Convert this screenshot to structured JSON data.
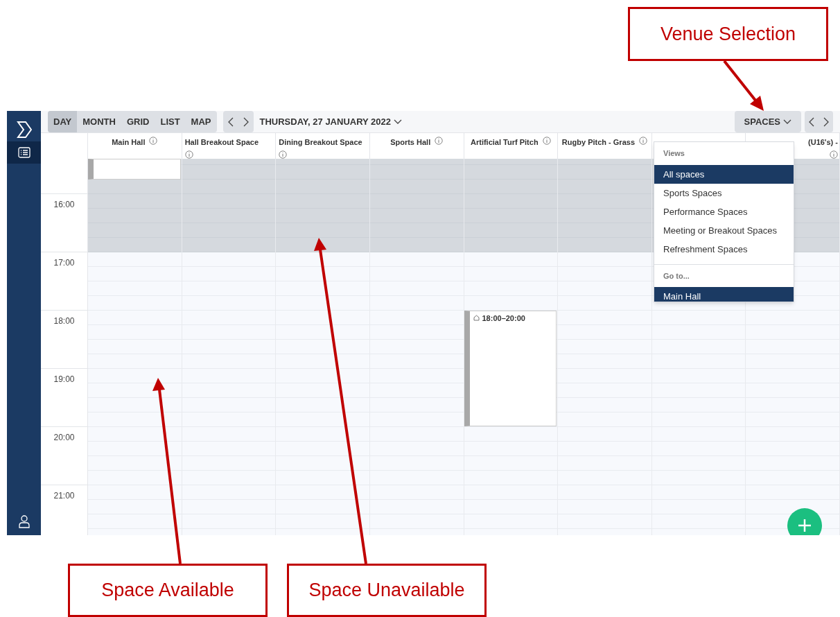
{
  "toolbar": {
    "views": [
      {
        "label": "DAY",
        "selected": true
      },
      {
        "label": "MONTH",
        "selected": false
      },
      {
        "label": "GRID",
        "selected": false
      },
      {
        "label": "LIST",
        "selected": false
      },
      {
        "label": "MAP",
        "selected": false
      }
    ],
    "date": "THURSDAY, 27 JANUARY 2022",
    "spaces_button": "SPACES"
  },
  "sidebar": {
    "items": [
      {
        "kind": "list",
        "selected": true
      },
      {
        "kind": "user",
        "selected": false
      }
    ]
  },
  "columns": [
    {
      "name": "Main Hall",
      "info_wrap": false,
      "unavailable": true,
      "events": [
        {
          "kind": "continued"
        }
      ]
    },
    {
      "name": "Hall Breakout Space",
      "info_wrap": true,
      "unavailable": true
    },
    {
      "name": "Dining Breakout Space",
      "info_wrap": true,
      "unavailable": true
    },
    {
      "name": "Sports Hall",
      "info_wrap": false,
      "unavailable": true
    },
    {
      "name": "Artificial Turf Pitch",
      "info_wrap": false,
      "unavailable": true,
      "events": [
        {
          "kind": "booking",
          "label": "18:00–20:00"
        }
      ]
    },
    {
      "name": "Rugby Pitch - Grass",
      "info_wrap": false,
      "unavailable": true
    },
    {
      "unavailable": true
    },
    {
      "name": "(U16's) -",
      "info_wrap": true,
      "unavailable": true
    }
  ],
  "times": [
    "16:00",
    "17:00",
    "18:00",
    "19:00",
    "20:00",
    "21:00"
  ],
  "dropdown": {
    "sections": [
      {
        "title": "Views",
        "items": [
          {
            "label": "All spaces",
            "selected": true
          },
          {
            "label": "Sports Spaces",
            "selected": false
          },
          {
            "label": "Performance Spaces",
            "selected": false
          },
          {
            "label": "Meeting or Breakout Spaces",
            "selected": false
          },
          {
            "label": "Refreshment Spaces",
            "selected": false
          }
        ]
      },
      {
        "title": "Go to...",
        "items": [
          {
            "label": "Main Hall",
            "selected": true
          }
        ]
      }
    ]
  },
  "annotations": [
    {
      "label": "Venue Selection"
    },
    {
      "label": "Space Available"
    },
    {
      "label": "Space Unavailable"
    }
  ]
}
